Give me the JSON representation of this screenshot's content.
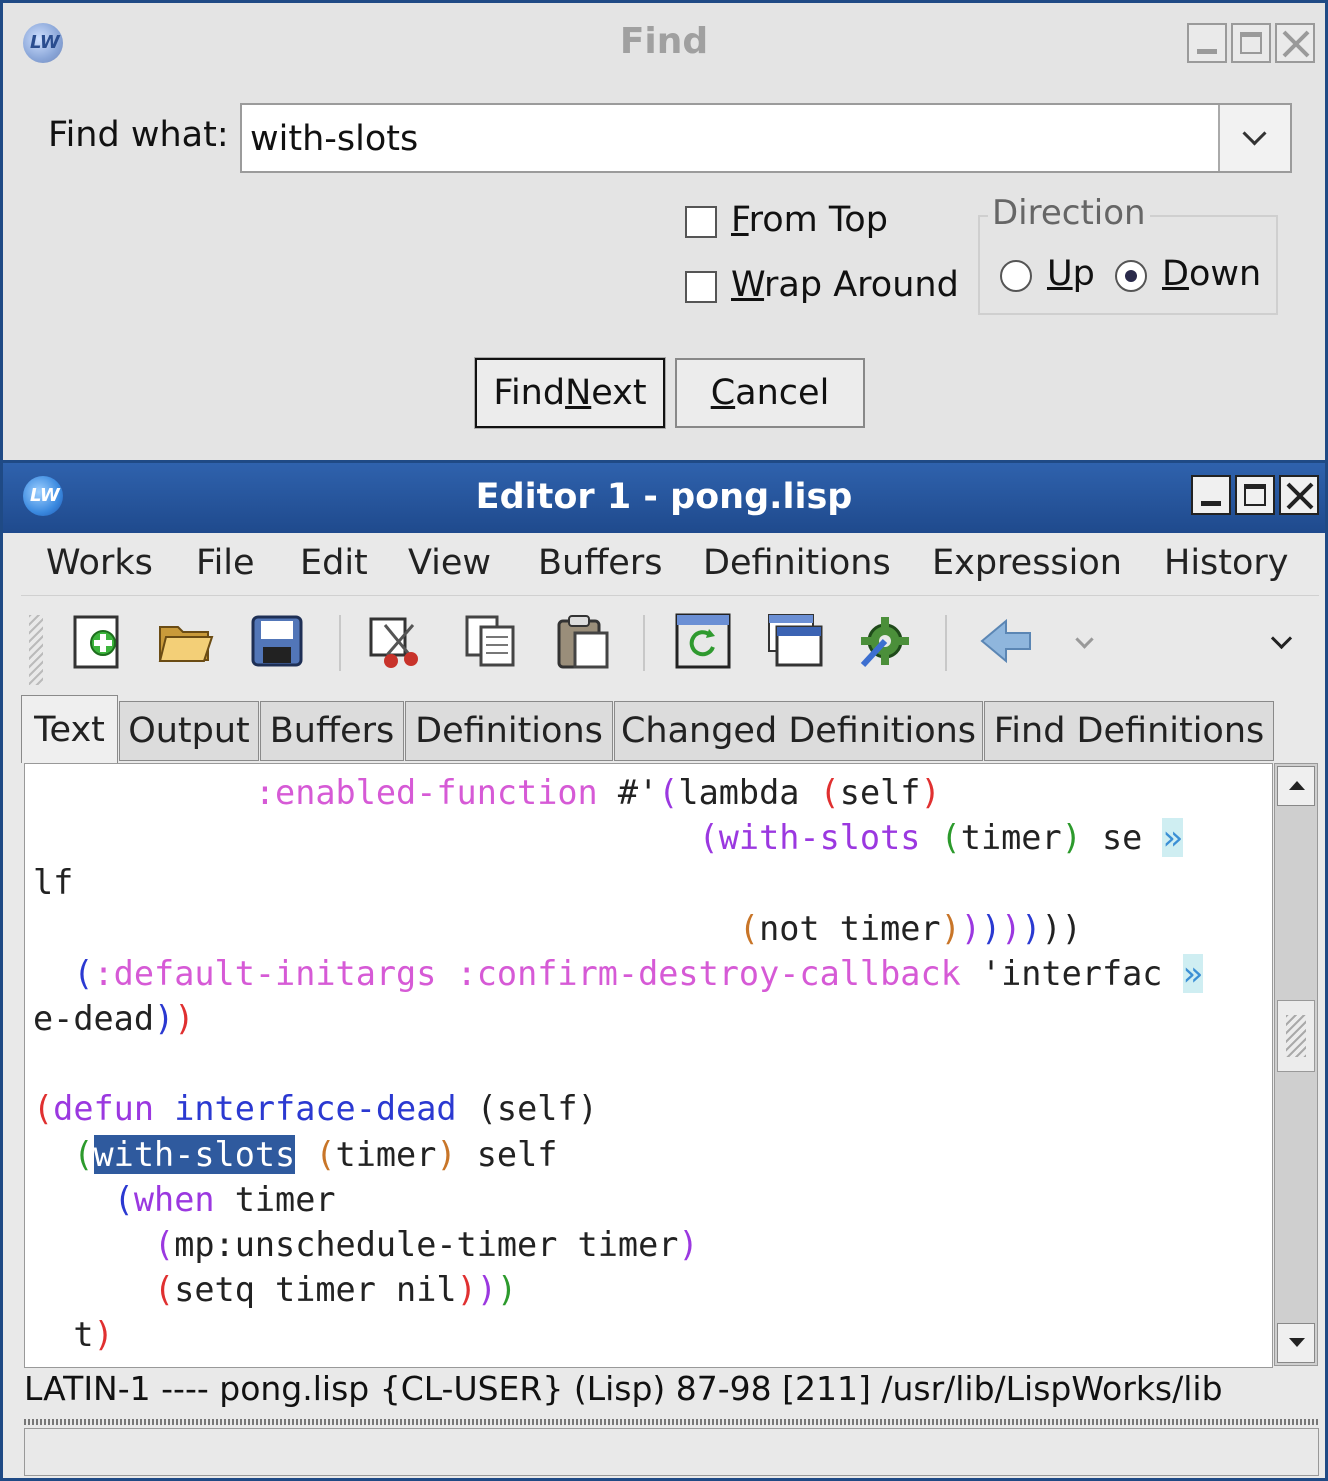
{
  "find_dialog": {
    "title": "Find",
    "find_what_label": "Find what:",
    "find_value": "with-slots",
    "from_top_label": "From Top",
    "wrap_around_label": "Wrap Around",
    "from_top_checked": false,
    "wrap_around_checked": false,
    "direction_label": "Direction",
    "up_label": "Up",
    "down_label": "Down",
    "direction_selected": "Down",
    "find_next_label": "Find Next",
    "cancel_label": "Cancel"
  },
  "editor": {
    "title": "Editor 1 - pong.lisp",
    "menu": [
      "Works",
      "File",
      "Edit",
      "View",
      "Buffers",
      "Definitions",
      "Expression",
      "History"
    ],
    "toolbar_icons": [
      "new-file-icon",
      "open-folder-icon",
      "save-icon",
      "cut-icon",
      "copy-icon",
      "paste-icon",
      "refresh-icon",
      "new-window-icon",
      "settings-gear-icon",
      "back-arrow-icon",
      "chevron-down-icon",
      "toolbar-overflow-icon"
    ],
    "tabs": [
      "Text",
      "Output",
      "Buffers",
      "Definitions",
      "Changed Definitions",
      "Find Definitions"
    ],
    "active_tab": "Text",
    "code_lines": [
      "             :enabled-function #'(lambda (self)",
      "                                   (with-slots (timer) se »",
      "lf",
      "                                     (not timer))))))",
      "  (:default-initargs :confirm-destroy-callback 'interfac »",
      "e-dead))",
      "",
      "(defun interface-dead (self)",
      "  (with-slots (timer) self",
      "    (when timer",
      "      (mp:unschedule-timer timer)",
      "      (setq timer nil)))",
      "  t)"
    ],
    "highlighted_match": "with-slots",
    "status_line": "LATIN-1 ---- pong.lisp    {CL-USER} (Lisp) 87-98 [211] /usr/lib/LispWorks/lib"
  },
  "colors": {
    "titlebar_active": "#1f4a8d",
    "keyword": "#d65ad6",
    "function_name": "#2b39d1",
    "selection": "#2f5a9e"
  }
}
